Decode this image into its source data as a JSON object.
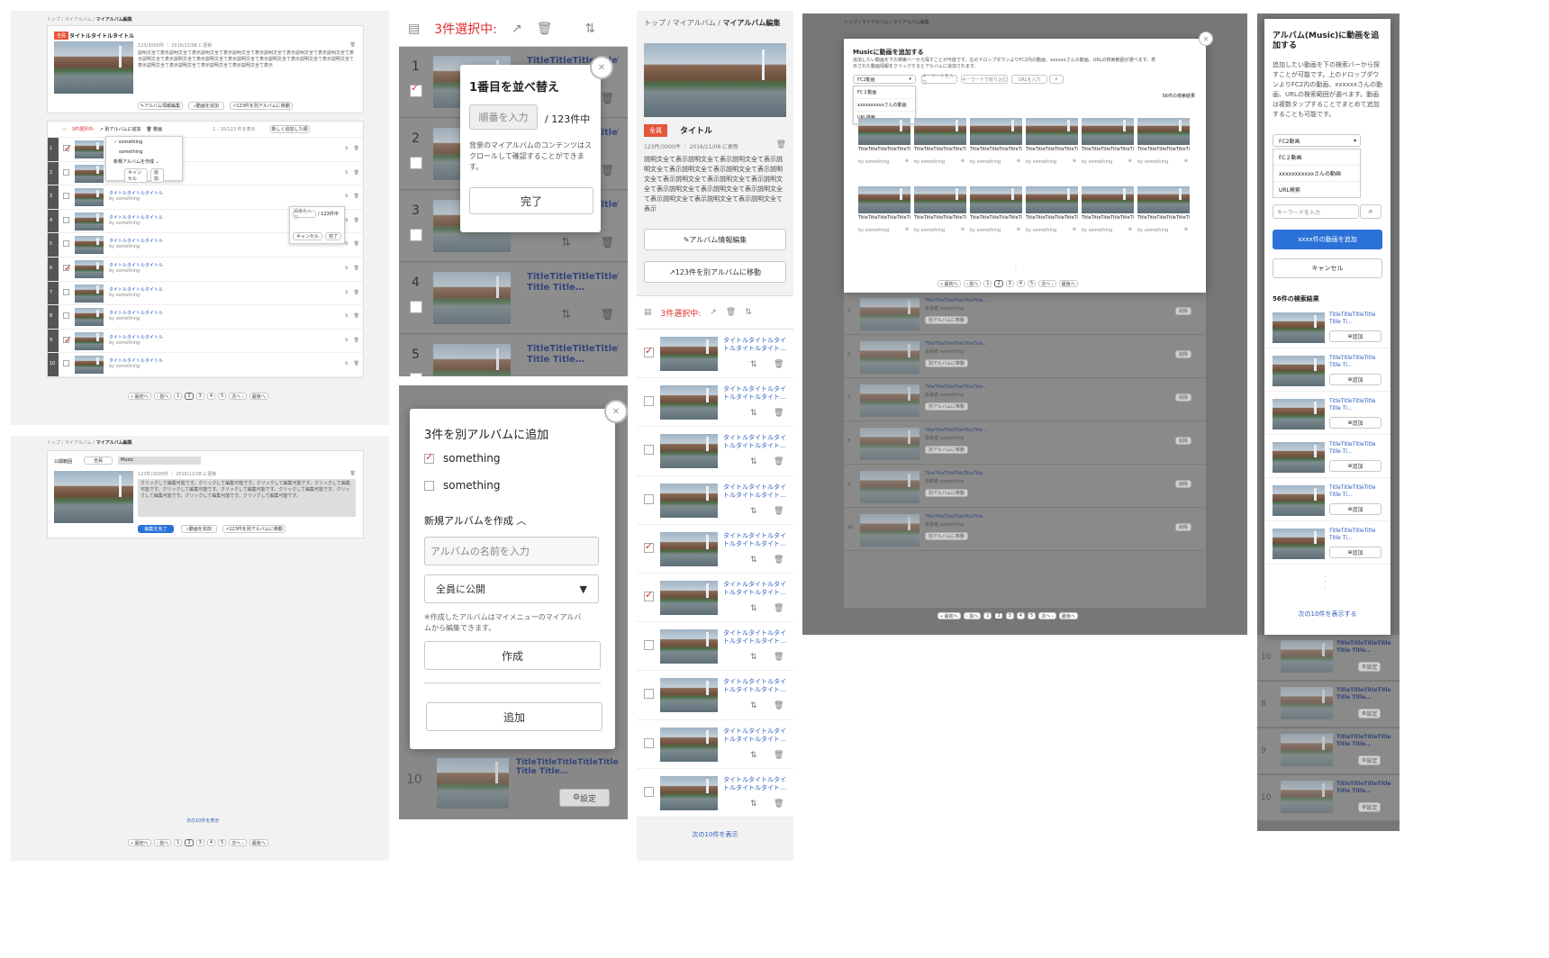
{
  "breadcrumb": {
    "top": "トップ",
    "album": "マイアルバム",
    "edit": "マイアルバム編集",
    "sep": "/"
  },
  "panel1": {
    "badge": "全員",
    "album_title": "タイトルタイトルタイトル",
    "meta": "123/3000件 ｜ 2016/11/08 に更新",
    "desc": "説明文全て表示説明文全て表示説明文全て表示説明文全て表示説明文全て表示説明文全て表示説明文全て表示説明文全て表示説明文全て表示説明文全て表示説明文全て表示説明文全て表示説明文全て表示説明文全て表示説明文全て表示説明文全て表示説明文全て表示説明文全て表示",
    "btn_info": "アルバム情報編集",
    "btn_add": "動画を追加",
    "btn_move": "123件を別アルバムに移動",
    "selected": "3件選択中:",
    "move_label": "別アルバムに追加",
    "video_label": "動画",
    "range": "1 - 10/123 件を表示",
    "sort": "新しく追加した順",
    "dropdown_items": [
      "something",
      "something"
    ],
    "new_album": "新規アルバムを作成",
    "cancel": "キャンセル",
    "add": "追加",
    "row_title": "タイトルタイトルタイトル",
    "row_by": "by something",
    "reorder_input": "順番を入力",
    "reorder_total": "/ 123件中",
    "reorder_cancel": "キャンセル",
    "reorder_done": "完了",
    "pages": [
      "« 最初へ",
      "‹ 前へ",
      "1",
      "2",
      "3",
      "4",
      "5",
      "次へ ›",
      "最後へ"
    ]
  },
  "panel2": {
    "scope_label": "公開範囲",
    "scope_value": "全員",
    "title_value": "Music",
    "meta": "123件/3000件 ｜ 2016/11/08 に更新",
    "desc": "クリックして編集可能です。クリックして編集可能です。クリックして編集可能です。クリックして編集可能です。クリックして編集可能です。クリックして編集可能です。クリックして編集可能です。クリックして編集可能です。クリックして編集可能です。クリックして編集可能です。",
    "btn_done": "編集を完了",
    "btn_add": "動画を追加",
    "btn_move": "123件を別アルバムに移動",
    "more": "次の10件を表示"
  },
  "panel3": {
    "selected": "3件選択中:",
    "reorder_title": "1番目を並べ替え",
    "reorder_placeholder": "順番を入力",
    "reorder_total": "/ 123件中",
    "reorder_help": "背景のマイアルバムのコンテンツはスクロールして確認することができます。",
    "reorder_done": "完了",
    "row_title": "TitleTitleTitleTitleTitleTitle Title Title…",
    "settings": "設定",
    "rows": [
      "1",
      "2",
      "3",
      "4",
      "5"
    ]
  },
  "panel4": {
    "title": "3件を別アルバムに追加",
    "options": [
      "something",
      "something"
    ],
    "new_album": "新規アルバムを作成",
    "name_placeholder": "アルバムの名前を入力",
    "scope": "全員に公開",
    "note": "※作成したアルバムはマイメニューのマイアルバムから編集できます。",
    "create": "作成",
    "add": "追加",
    "row_num": "10",
    "row_title": "TitleTitleTitleTitleTitle Title Title…",
    "settings": "設定"
  },
  "panel5": {
    "badge": "全員",
    "album_title": "タイトル",
    "meta": "123件/3000件 ｜ 2016/11/08 に更新",
    "desc": "説明文全て表示説明文全て表示説明文全て表示説明文全て表示説明文全て表示説明文全て表示説明文全て表示説明文全て表示説明文全て表示説明文全て表示説明文全て表示説明文全て表示説明文全て表示説明文全て表示説明文全て表示説明文全て表示",
    "btn_info": "アルバム情報編集",
    "btn_move": "123件を別アルバムに移動",
    "selected": "3件選択中:",
    "row_title": "タイトルタイトルタイトルタイトルタイト…",
    "more": "次の10件を表示"
  },
  "panel6": {
    "modal_title": "Musicに動画を追加する",
    "modal_desc": "追加したい動画を下の検索バーから探すことが可能です。左のドロップダウンよりFC2内の動画、xxxxxxさんの動画、URLの検索範囲が選べます。表示された動画情報をクリックするとアルバムに追加されます。",
    "source": "FC2動画",
    "options": [
      "FC２動画",
      "xxxxxxxxxxさんの動画",
      "URL検索"
    ],
    "kw_placeholder": "キーワードを入力",
    "kw2": "キーワードで絞り込む",
    "url_placeholder": "URLを入力",
    "results": "56件の検索結果",
    "video_title": "TitleTitleTitleTitleTitleTitleTi…",
    "video_by": "by something",
    "pages": [
      "« 最初へ",
      "‹ 前へ",
      "1",
      "2",
      "3",
      "4",
      "5",
      "次へ ›",
      "最後へ"
    ],
    "bg_title": "TitleTitleTitleTitleTitleTitle…",
    "bg_by": "投稿者 something",
    "bg_move": "別アルバムに移動",
    "bg_set": "削除",
    "bg_nums": [
      "5",
      "6",
      "7",
      "8",
      "9",
      "10"
    ]
  },
  "panel7": {
    "title": "アルバム(Music)に動画を追加する",
    "desc": "追加したい動画を下の検索バーから探すことが可能です。上のドロップダウンよりFC2内の動画、xxxxxxさんの動画、URLの検索範囲が選べます。動画は複数タップすることでまとめて追加することも可能です。",
    "source": "FC2動画",
    "options": [
      "FC２動画",
      "xxxxxxxxxxxさんの動画",
      "URL検索"
    ],
    "kw_placeholder": "キーワードを入力",
    "add_btn": "xxxx件の動画を追加",
    "cancel": "キャンセル",
    "results": "56件の検索結果",
    "item_title": "TitleTitleTitleTitle Title Ti…",
    "item_add": "追加",
    "more": "次の10件を表示する",
    "bg_nums": [
      "10",
      "8",
      "9",
      "10"
    ],
    "bg_title": "TitleTitleTitleTitle Title Title…",
    "bg_set": "設定"
  }
}
